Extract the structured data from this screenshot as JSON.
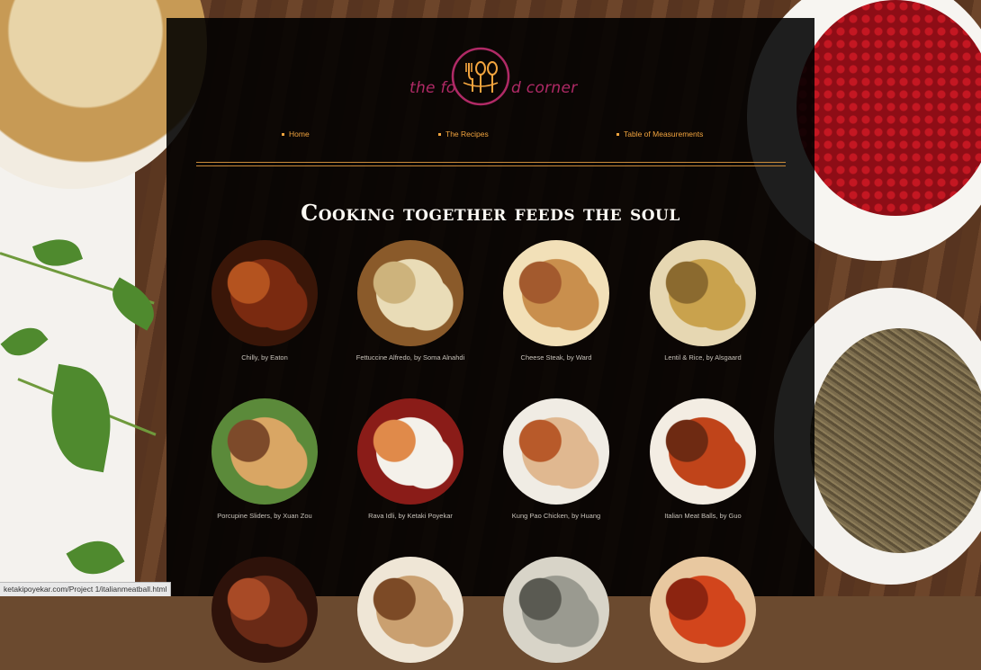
{
  "logo": {
    "left_text": "the fo",
    "right_text": "d corner",
    "mark_icon": "fork-spoon-monogram-icon"
  },
  "nav": [
    {
      "label": "Home"
    },
    {
      "label": "The Recipes"
    },
    {
      "label": "Table of Measurements"
    }
  ],
  "headline": "Cooking together feeds the soul",
  "recipes": [
    {
      "caption": "Chilly, by Eaton",
      "colors": [
        "#7a2a10",
        "#b4531f",
        "#3a1608"
      ]
    },
    {
      "caption": "Fettuccine Alfredo, by Soma Alnahdi",
      "colors": [
        "#e9dcb7",
        "#cdb37c",
        "#8a5a2a"
      ]
    },
    {
      "caption": "Cheese Steak, by Ward",
      "colors": [
        "#c98f4d",
        "#a35a2e",
        "#f2e0b8"
      ]
    },
    {
      "caption": "Lentil & Rice, by Alsgaard",
      "colors": [
        "#c9a24d",
        "#8b6a2f",
        "#e6d7b2"
      ]
    },
    {
      "caption": "Porcupine Sliders, by Xuan Zou",
      "colors": [
        "#d9a664",
        "#7d4a2a",
        "#5b8a3a"
      ]
    },
    {
      "caption": "Rava Idli, by Ketaki Poyekar",
      "colors": [
        "#f4f1ea",
        "#e08a4a",
        "#8a1c18"
      ]
    },
    {
      "caption": "Kung Pao Chicken, by Huang",
      "colors": [
        "#e0b890",
        "#b85a2a",
        "#f0ece4"
      ]
    },
    {
      "caption": "Italian Meat Balls, by Guo",
      "colors": [
        "#c0441a",
        "#6e2a12",
        "#f3ede3"
      ]
    },
    {
      "caption": "",
      "colors": [
        "#6a2a16",
        "#a84a26",
        "#2e120a"
      ]
    },
    {
      "caption": "",
      "colors": [
        "#caa070",
        "#7c4a26",
        "#efe6d6"
      ]
    },
    {
      "caption": "",
      "colors": [
        "#9a9a90",
        "#5a5a52",
        "#d8d4c8"
      ]
    },
    {
      "caption": "",
      "colors": [
        "#d2451c",
        "#8c2410",
        "#e8c8a0"
      ]
    }
  ],
  "status_url": "ketakipoyekar.com/Project 1/italianmeatball.html",
  "colors": {
    "accent": "#f2a43e",
    "logo": "#b02a66",
    "panel": "#000000"
  }
}
